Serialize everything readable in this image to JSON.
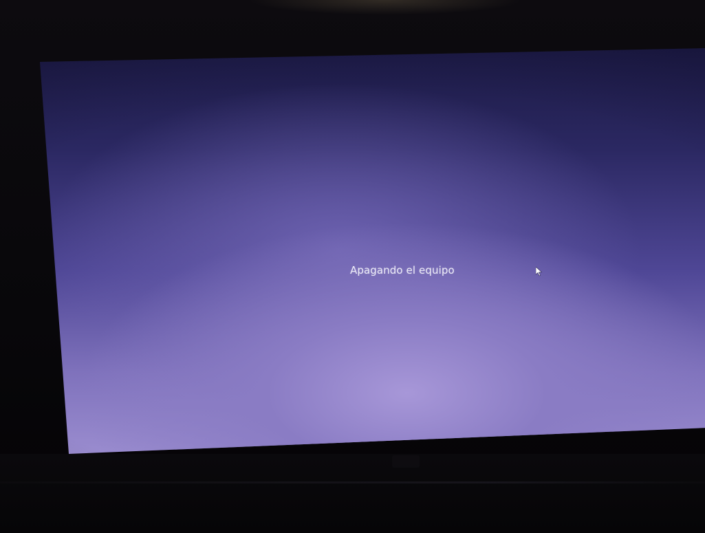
{
  "screen": {
    "status_message": "Apagando el equipo",
    "background_color_top": "#1c1a45",
    "background_color_bottom": "#9a8ccf",
    "text_color": "#ecebf7"
  },
  "cursor": {
    "icon": "mouse-pointer-icon"
  }
}
